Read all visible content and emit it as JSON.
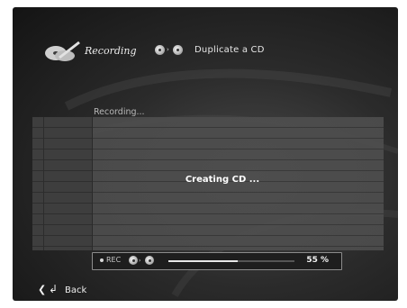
{
  "header": {
    "section_title": "Recording",
    "action_title": "Duplicate a CD",
    "icon": "cd-record-icon",
    "cd_pair_icon": "disc-to-disc-icon"
  },
  "panel": {
    "label": "Recording...",
    "message": "Creating CD ..."
  },
  "progress": {
    "rec_label": "REC",
    "percent_text": "55 %",
    "percent_value": 0.55
  },
  "footer": {
    "back_label": "Back",
    "icons": [
      "chevron-left-icon",
      "return-icon"
    ]
  },
  "colors": {
    "background_dark": "#141414",
    "background_mid": "#4a4a4a",
    "text": "#ececec"
  }
}
